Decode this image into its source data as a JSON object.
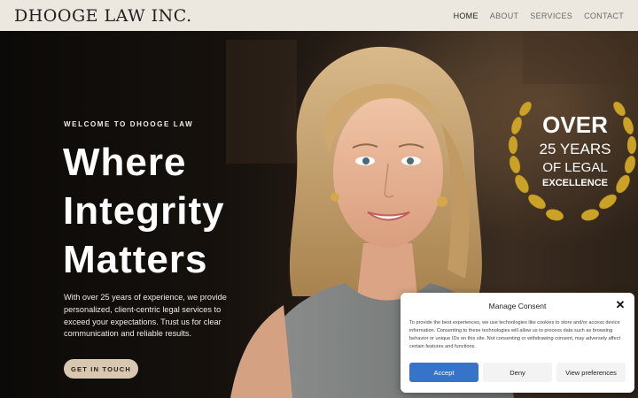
{
  "header": {
    "logo": "DHOOGE LAW INC.",
    "nav": [
      "HOME",
      "ABOUT",
      "SERVICES",
      "CONTACT"
    ],
    "active_nav": "HOME"
  },
  "hero": {
    "eyebrow": "WELCOME TO DHOOGE LAW",
    "headline": [
      "Where",
      "Integrity",
      "Matters"
    ],
    "body": "With over 25 years of experience, we provide personalized, client-centric legal services to exceed your expectations. Trust us for clear communication and reliable results.",
    "cta_label": "GET IN TOUCH"
  },
  "badge": {
    "line1": "OVER",
    "line2": "25 YEARS",
    "line3": "OF LEGAL",
    "line4": "EXCELLENCE"
  },
  "consent": {
    "title": "Manage Consent",
    "text": "To provide the best experiences, we use technologies like cookies to store and/or access device information. Consenting to these technologies will allow us to process data such as browsing behavior or unique IDs on this site. Not consenting or withdrawing consent, may adversely affect certain features and functions.",
    "accept_label": "Accept",
    "deny_label": "Deny",
    "prefs_label": "View preferences"
  },
  "colors": {
    "header_bg": "#ece8df",
    "cta_bg": "#d8c8b2",
    "accept_blue": "#3574c8",
    "badge_gold": "#c9a227"
  }
}
